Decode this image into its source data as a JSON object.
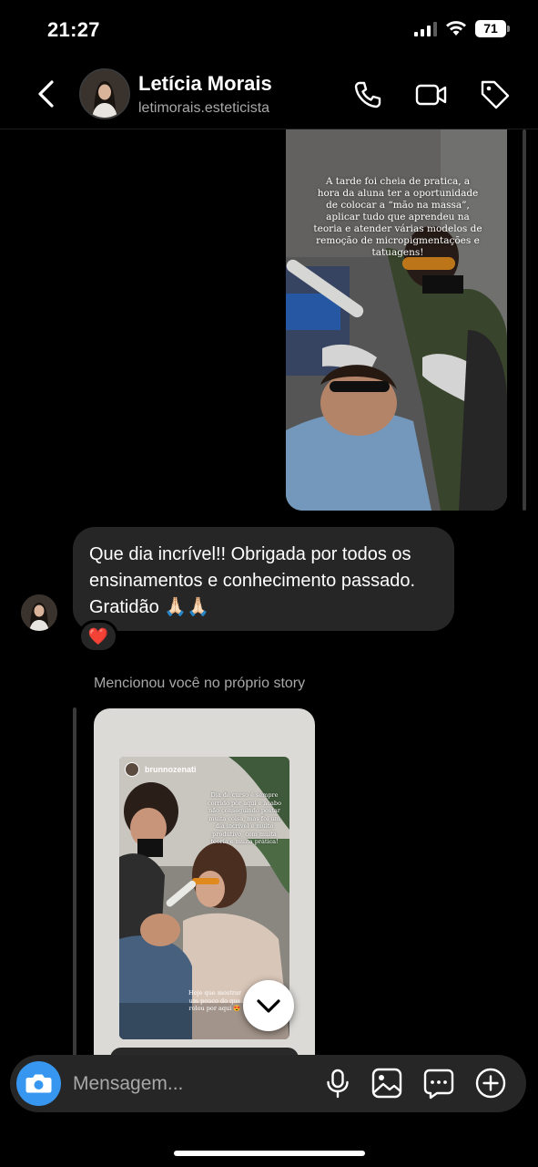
{
  "status_bar": {
    "time": "21:27",
    "battery": "71"
  },
  "header": {
    "name": "Letícia Morais",
    "username": "letimorais.esteticista",
    "icons": [
      "back-icon",
      "phone-icon",
      "video-icon",
      "tag-icon"
    ]
  },
  "story1": {
    "caption": "A tarde foi cheia de pratica, a hora da aluna ter a oportunidade de colocar a “mão na massa”, aplicar tudo que aprendeu na teoria e atender várias modelos de remoção de micropigmentações e tatuagens!"
  },
  "message": {
    "text": "Que dia incrível!! Obrigada por todos os ensinamentos e conhecimento passado. Gratidão 🙏🏻🙏🏻",
    "reaction": "❤️"
  },
  "mention": {
    "label": "Mencionou você no próprio story",
    "handle": "brunnozenati",
    "caption": "Dia de curso é sempre corrido por aqui e acabo não conseguindo postar muita coisa, mas foi um dia incrível e muito produtivo, com muita teoria e muita prática!",
    "caption2": "Hoje que mostrar um pouco do que rolou por aqui 😍"
  },
  "composer": {
    "placeholder": "Mensagem...",
    "icons": [
      "camera-icon",
      "microphone-icon",
      "gallery-icon",
      "sticker-icon",
      "plus-icon"
    ]
  },
  "colors": {
    "background": "#000000",
    "bubble": "#262626",
    "accent": "#3797f0",
    "secondary_text": "#a8a8a8"
  }
}
